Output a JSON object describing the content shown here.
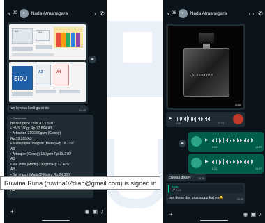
{
  "left_chat": {
    "header": {
      "back_glyph": "‹",
      "unread_count": "20",
      "contact_name": "Nada Atmanegara",
      "video_glyph": "▭",
      "call_glyph": "✆"
    },
    "image_msg": {
      "labels": {
        "a3_top": "A3",
        "a4_top": "A4",
        "a3_paper": "A3",
        "a4_paper": "A4",
        "sidu": "SiDU",
        "a3_sticker": "A3",
        "a4_sticker": "A4"
      },
      "fwd_glyph": "➦"
    },
    "caption_msg": {
      "text": "run kenyaa kecil ga sii ini",
      "time": "21.25"
    },
    "price_msg": {
      "sender": "~ Otemedian",
      "intro": "Berikut price color A3 1 Sisi :",
      "lines": [
        "• HVS 100gr Rp.17.864/A3",
        "• Artcarton 210/260gsm (Glossy)",
        "  Rp.19.285/A3",
        "• Mattepaper 150gsm (Matte) Rp.18.270/",
        "  A3",
        "• Artpaper (Glossy) 150gsm Rp.18.270/",
        "  A3",
        "• Via linen (Matte) 230gsm Rp.27.405/",
        "  A3",
        "• Bw import (Matte)260gsm Rp.24.360/",
        "  A3",
        "• Briefcard (Matte) 160gsm Rp.23.345/",
        "  A3"
      ]
    },
    "input_bar": {
      "plus": "+",
      "camera": "◉",
      "image": "▣",
      "mic": "♪"
    }
  },
  "right_chat": {
    "header": {
      "back_glyph": "‹",
      "unread_count": "26",
      "contact_name": "Nada Atmanegara",
      "video_glyph": "▭",
      "call_glyph": "✆"
    },
    "product_image": {
      "brand_text": "ATTENTION",
      "time": "21.52"
    },
    "voice_in": {
      "duration": "1:00",
      "time": "21.52",
      "play": "▶"
    },
    "voice_out_1": {
      "duration": "0:24",
      "time": "19.27",
      "play": "▶"
    },
    "voice_out_2": {
      "duration": "0:24",
      "time": "19.27",
      "play": "▶"
    },
    "text_in": {
      "text": "cakeaa dikayy",
      "time": "19.28"
    },
    "reply_msg": {
      "quote_sender": "Anda",
      "quote_text": "🎤 0:24",
      "text": "pas demo day gaada gpp kali ya😃",
      "time": "20.09"
    },
    "fwd_glyph": "➦",
    "input_bar": {
      "plus": "+",
      "camera": "◉",
      "image": "▣",
      "mic": "♪"
    }
  },
  "tooltip": {
    "text": "Ruwina Runa (ruwina02diah@gmail.com) is signed in"
  },
  "colors": {
    "chat_bg": "#0b141a",
    "incoming": "#1f2c34",
    "outgoing": "#005c4b",
    "accent": "#25d366"
  }
}
